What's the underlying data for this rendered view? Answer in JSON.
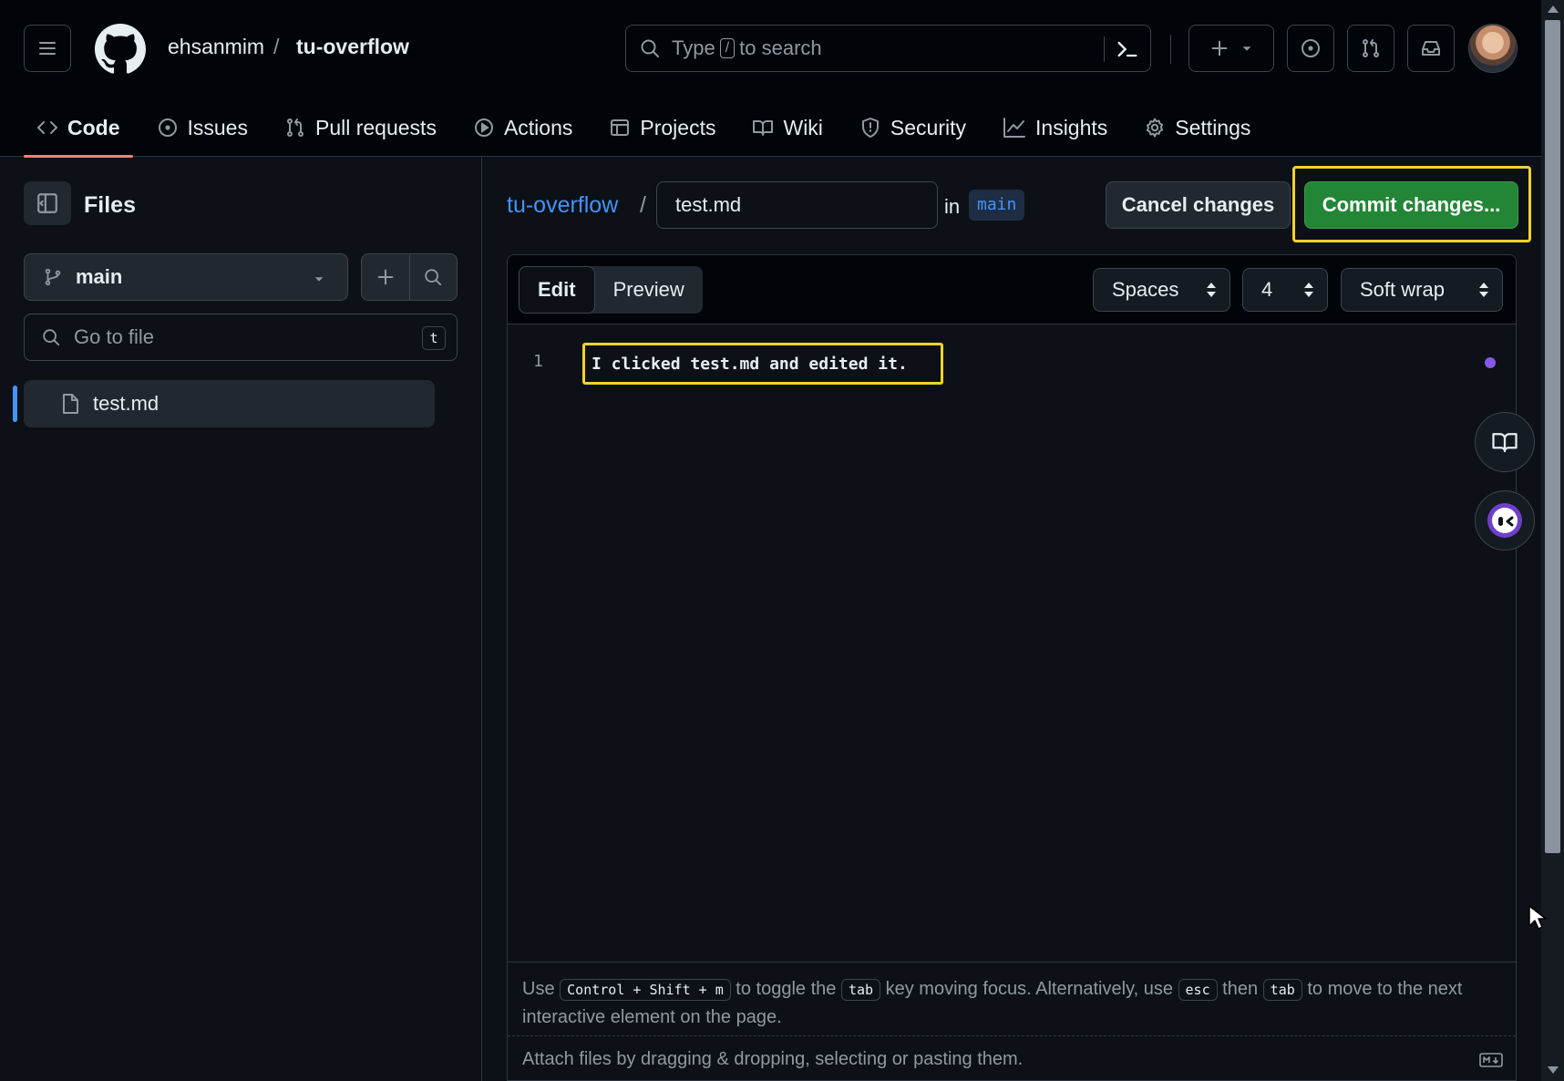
{
  "header": {
    "owner": "ehsanmim",
    "separator": "/",
    "repo": "tu-overflow",
    "search_prefix": "Type",
    "search_key": "/",
    "search_suffix": "to search"
  },
  "repo_nav": {
    "tabs": [
      {
        "label": "Code",
        "icon": "code-icon",
        "active": true
      },
      {
        "label": "Issues",
        "icon": "issue-opened-icon"
      },
      {
        "label": "Pull requests",
        "icon": "git-pull-request-icon"
      },
      {
        "label": "Actions",
        "icon": "play-icon"
      },
      {
        "label": "Projects",
        "icon": "table-icon"
      },
      {
        "label": "Wiki",
        "icon": "book-icon"
      },
      {
        "label": "Security",
        "icon": "shield-icon"
      },
      {
        "label": "Insights",
        "icon": "graph-icon"
      },
      {
        "label": "Settings",
        "icon": "gear-icon"
      }
    ]
  },
  "sidebar": {
    "title": "Files",
    "branch": "main",
    "goto_placeholder": "Go to file",
    "goto_shortcut": "t",
    "files": [
      {
        "name": "test.md",
        "selected": true
      }
    ]
  },
  "editor": {
    "repo_link": "tu-overflow",
    "path_sep": "/",
    "filename": "test.md",
    "in_label": "in",
    "branch": "main",
    "cancel_label": "Cancel changes",
    "commit_label": "Commit changes...",
    "tabs": {
      "edit": "Edit",
      "preview": "Preview"
    },
    "indent_mode": "Spaces",
    "indent_size": "4",
    "wrap_mode": "Soft wrap",
    "lines": [
      {
        "number": "1",
        "text": "I clicked test.md and edited it."
      }
    ],
    "hint": {
      "use": "Use",
      "shortcut": "Control + Shift + m",
      "to_toggle": "to toggle the",
      "tab_key": "tab",
      "rest": "key moving focus. Alternatively, use",
      "esc_key": "esc",
      "then": "then",
      "tab_key2": "tab",
      "end": "to move to the next interactive element on the page."
    },
    "attach_text": "Attach files by dragging & dropping, selecting or pasting them."
  },
  "colors": {
    "accent_blue": "#4493f8",
    "commit_green": "#238636",
    "highlight_yellow": "#f2d22e",
    "tab_underline": "#f78166"
  }
}
